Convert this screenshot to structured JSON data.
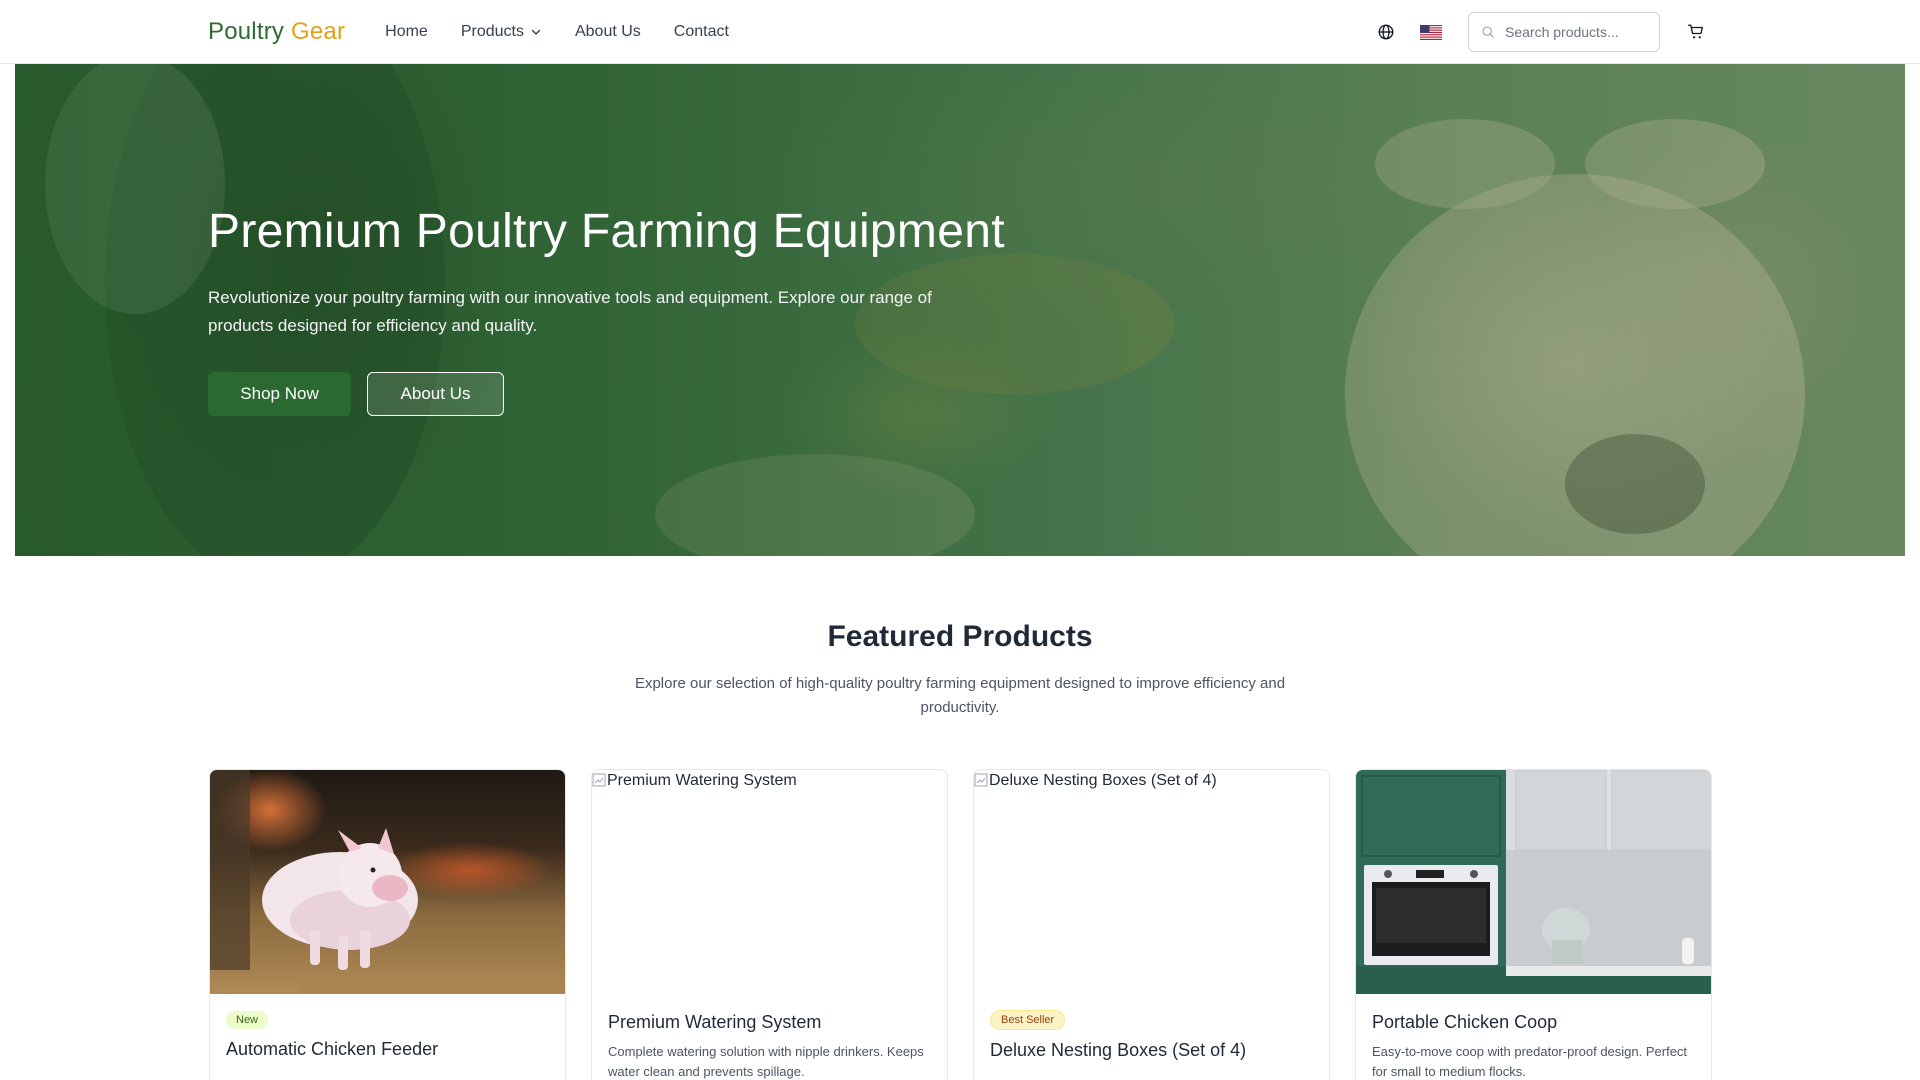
{
  "header": {
    "logo_primary": "Poultry",
    "logo_accent": "Gear",
    "nav": [
      {
        "label": "Home"
      },
      {
        "label": "Products"
      },
      {
        "label": "About Us"
      },
      {
        "label": "Contact"
      }
    ],
    "search_placeholder": "Search products...",
    "icons": [
      "globe-icon",
      "us-flag-icon",
      "search-icon",
      "cart-icon"
    ]
  },
  "hero": {
    "title": "Premium Poultry Farming Equipment",
    "subtitle": "Revolutionize your poultry farming with our innovative tools and equipment. Explore our range of products designed for efficiency and quality.",
    "primary_button": "Shop Now",
    "secondary_button": "About Us"
  },
  "featured": {
    "title": "Featured Products",
    "subtitle": "Explore our selection of high-quality poultry farming equipment designed to improve efficiency and productivity.",
    "products": [
      {
        "name": "Automatic Chicken Feeder",
        "badge": "New",
        "description": "",
        "image_alt": ""
      },
      {
        "name": "Premium Watering System",
        "badge": "",
        "description": "Complete watering solution with nipple drinkers. Keeps water clean and prevents spillage.",
        "image_alt": "Premium Watering System"
      },
      {
        "name": "Deluxe Nesting Boxes (Set of 4)",
        "badge": "Best Seller",
        "description": "",
        "image_alt": "Deluxe Nesting Boxes (Set of 4)"
      },
      {
        "name": "Portable Chicken Coop",
        "badge": "",
        "description": "Easy-to-move coop with predator-proof design. Perfect for small to medium flocks.",
        "image_alt": ""
      }
    ]
  },
  "colors": {
    "brand_green": "#2a6a31",
    "brand_gold": "#e3a11a"
  }
}
